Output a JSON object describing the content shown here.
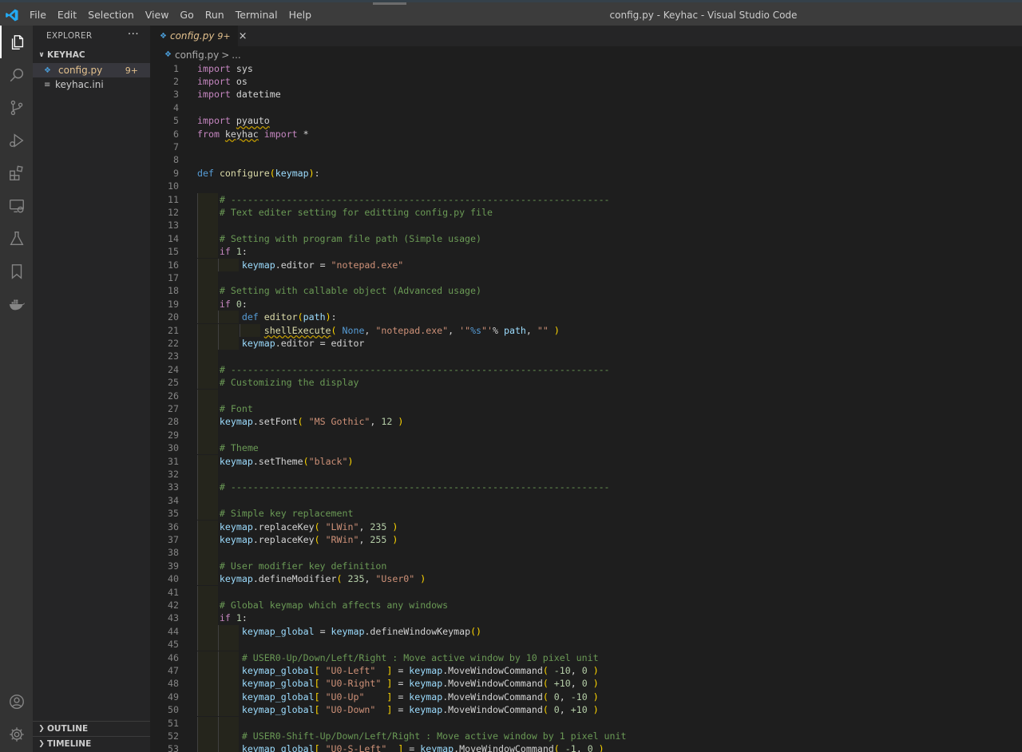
{
  "window": {
    "title": "config.py - Keyhac - Visual Studio Code",
    "menu": [
      "File",
      "Edit",
      "Selection",
      "View",
      "Go",
      "Run",
      "Terminal",
      "Help"
    ]
  },
  "activity_bar": {
    "items": [
      "files-icon",
      "search-icon",
      "source-control-icon",
      "run-debug-icon",
      "extensions-icon",
      "remote-explorer-icon",
      "testing-icon",
      "bookmarks-icon",
      "docker-icon"
    ],
    "bottom": [
      "account-icon",
      "settings-gear-icon"
    ]
  },
  "sidebar": {
    "header": "EXPLORER",
    "more": "···",
    "folder": "KEYHAC",
    "files": [
      {
        "name": "config.py",
        "badge": "9+",
        "selected": true
      },
      {
        "name": "keyhac.ini",
        "badge": "",
        "selected": false
      }
    ],
    "outline": "OUTLINE",
    "timeline": "TIMELINE"
  },
  "editor": {
    "tab": {
      "label": "config.py",
      "badge": "9+",
      "close": "×"
    },
    "breadcrumb": {
      "file": "config.py",
      "sep": ">",
      "rest": "..."
    },
    "lines": [
      [
        {
          "t": "import",
          "c": "k"
        },
        {
          "t": " sys"
        }
      ],
      [
        {
          "t": "import",
          "c": "k"
        },
        {
          "t": " os"
        }
      ],
      [
        {
          "t": "import",
          "c": "k"
        },
        {
          "t": " datetime"
        }
      ],
      [],
      [
        {
          "t": "import",
          "c": "k"
        },
        {
          "t": " "
        },
        {
          "t": "pyauto",
          "c": "sq"
        }
      ],
      [
        {
          "t": "from",
          "c": "k"
        },
        {
          "t": " "
        },
        {
          "t": "keyhac",
          "c": "sq"
        },
        {
          "t": " "
        },
        {
          "t": "import",
          "c": "k"
        },
        {
          "t": " *"
        }
      ],
      [],
      [],
      [
        {
          "t": "def",
          "c": "d"
        },
        {
          "t": " "
        },
        {
          "t": "configure",
          "c": "f"
        },
        {
          "t": "(",
          "c": "p"
        },
        {
          "t": "keymap",
          "c": "v"
        },
        {
          "t": ")",
          "c": "p"
        },
        {
          "t": ":"
        }
      ],
      [],
      [
        {
          "t": "    "
        },
        {
          "t": "# --------------------------------------------------------------------",
          "c": "c"
        }
      ],
      [
        {
          "t": "    "
        },
        {
          "t": "# Text editer setting for editting config.py file",
          "c": "c"
        }
      ],
      [],
      [
        {
          "t": "    "
        },
        {
          "t": "# Setting with program file path (Simple usage)",
          "c": "c"
        }
      ],
      [
        {
          "t": "    "
        },
        {
          "t": "if",
          "c": "k"
        },
        {
          "t": " "
        },
        {
          "t": "1",
          "c": "n"
        },
        {
          "t": ":"
        }
      ],
      [
        {
          "t": "        "
        },
        {
          "t": "keymap",
          "c": "v"
        },
        {
          "t": ".editor = "
        },
        {
          "t": "\"notepad.exe\"",
          "c": "s"
        }
      ],
      [],
      [
        {
          "t": "    "
        },
        {
          "t": "# Setting with callable object (Advanced usage)",
          "c": "c"
        }
      ],
      [
        {
          "t": "    "
        },
        {
          "t": "if",
          "c": "k"
        },
        {
          "t": " "
        },
        {
          "t": "0",
          "c": "n"
        },
        {
          "t": ":"
        }
      ],
      [
        {
          "t": "        "
        },
        {
          "t": "def",
          "c": "d"
        },
        {
          "t": " "
        },
        {
          "t": "editor",
          "c": "f"
        },
        {
          "t": "(",
          "c": "p"
        },
        {
          "t": "path",
          "c": "v"
        },
        {
          "t": ")",
          "c": "p"
        },
        {
          "t": ":"
        }
      ],
      [
        {
          "t": "            "
        },
        {
          "t": "shellExecute",
          "c": "f sq"
        },
        {
          "t": "(",
          "c": "p"
        },
        {
          "t": " "
        },
        {
          "t": "None",
          "c": "d"
        },
        {
          "t": ", "
        },
        {
          "t": "\"notepad.exe\"",
          "c": "s"
        },
        {
          "t": ", "
        },
        {
          "t": "'\"",
          "c": "s"
        },
        {
          "t": "%s",
          "c": "d"
        },
        {
          "t": "\"'",
          "c": "s"
        },
        {
          "t": "% "
        },
        {
          "t": "path",
          "c": "v"
        },
        {
          "t": ", "
        },
        {
          "t": "\"\"",
          "c": "s"
        },
        {
          "t": " "
        },
        {
          "t": ")",
          "c": "p"
        }
      ],
      [
        {
          "t": "        "
        },
        {
          "t": "keymap",
          "c": "v"
        },
        {
          "t": ".editor = editor"
        }
      ],
      [],
      [
        {
          "t": "    "
        },
        {
          "t": "# --------------------------------------------------------------------",
          "c": "c"
        }
      ],
      [
        {
          "t": "    "
        },
        {
          "t": "# Customizing the display",
          "c": "c"
        }
      ],
      [],
      [
        {
          "t": "    "
        },
        {
          "t": "# Font",
          "c": "c"
        }
      ],
      [
        {
          "t": "    "
        },
        {
          "t": "keymap",
          "c": "v"
        },
        {
          "t": ".setFont"
        },
        {
          "t": "(",
          "c": "p"
        },
        {
          "t": " "
        },
        {
          "t": "\"MS Gothic\"",
          "c": "s"
        },
        {
          "t": ", "
        },
        {
          "t": "12",
          "c": "n"
        },
        {
          "t": " "
        },
        {
          "t": ")",
          "c": "p"
        }
      ],
      [],
      [
        {
          "t": "    "
        },
        {
          "t": "# Theme",
          "c": "c"
        }
      ],
      [
        {
          "t": "    "
        },
        {
          "t": "keymap",
          "c": "v"
        },
        {
          "t": ".setTheme"
        },
        {
          "t": "(",
          "c": "p"
        },
        {
          "t": "\"black\"",
          "c": "s"
        },
        {
          "t": ")",
          "c": "p"
        }
      ],
      [],
      [
        {
          "t": "    "
        },
        {
          "t": "# --------------------------------------------------------------------",
          "c": "c"
        }
      ],
      [],
      [
        {
          "t": "    "
        },
        {
          "t": "# Simple key replacement",
          "c": "c"
        }
      ],
      [
        {
          "t": "    "
        },
        {
          "t": "keymap",
          "c": "v"
        },
        {
          "t": ".replaceKey"
        },
        {
          "t": "(",
          "c": "p"
        },
        {
          "t": " "
        },
        {
          "t": "\"LWin\"",
          "c": "s"
        },
        {
          "t": ", "
        },
        {
          "t": "235",
          "c": "n"
        },
        {
          "t": " "
        },
        {
          "t": ")",
          "c": "p"
        }
      ],
      [
        {
          "t": "    "
        },
        {
          "t": "keymap",
          "c": "v"
        },
        {
          "t": ".replaceKey"
        },
        {
          "t": "(",
          "c": "p"
        },
        {
          "t": " "
        },
        {
          "t": "\"RWin\"",
          "c": "s"
        },
        {
          "t": ", "
        },
        {
          "t": "255",
          "c": "n"
        },
        {
          "t": " "
        },
        {
          "t": ")",
          "c": "p"
        }
      ],
      [],
      [
        {
          "t": "    "
        },
        {
          "t": "# User modifier key definition",
          "c": "c"
        }
      ],
      [
        {
          "t": "    "
        },
        {
          "t": "keymap",
          "c": "v"
        },
        {
          "t": ".defineModifier"
        },
        {
          "t": "(",
          "c": "p"
        },
        {
          "t": " "
        },
        {
          "t": "235",
          "c": "n"
        },
        {
          "t": ", "
        },
        {
          "t": "\"User0\"",
          "c": "s"
        },
        {
          "t": " "
        },
        {
          "t": ")",
          "c": "p"
        }
      ],
      [],
      [
        {
          "t": "    "
        },
        {
          "t": "# Global keymap which affects any windows",
          "c": "c"
        }
      ],
      [
        {
          "t": "    "
        },
        {
          "t": "if",
          "c": "k"
        },
        {
          "t": " "
        },
        {
          "t": "1",
          "c": "n"
        },
        {
          "t": ":"
        }
      ],
      [
        {
          "t": "        "
        },
        {
          "t": "keymap_global",
          "c": "v"
        },
        {
          "t": " = "
        },
        {
          "t": "keymap",
          "c": "v"
        },
        {
          "t": ".defineWindowKeymap"
        },
        {
          "t": "()",
          "c": "p"
        }
      ],
      [],
      [
        {
          "t": "        "
        },
        {
          "t": "# USER0-Up/Down/Left/Right : Move active window by 10 pixel unit",
          "c": "c"
        }
      ],
      [
        {
          "t": "        "
        },
        {
          "t": "keymap_global",
          "c": "v"
        },
        {
          "t": "[",
          "c": "p"
        },
        {
          "t": " "
        },
        {
          "t": "\"U0-Left\"",
          "c": "s"
        },
        {
          "t": "  "
        },
        {
          "t": "]",
          "c": "p"
        },
        {
          "t": " = "
        },
        {
          "t": "keymap",
          "c": "v"
        },
        {
          "t": ".MoveWindowCommand"
        },
        {
          "t": "(",
          "c": "p"
        },
        {
          "t": " "
        },
        {
          "t": "-10",
          "c": "n"
        },
        {
          "t": ", "
        },
        {
          "t": "0",
          "c": "n"
        },
        {
          "t": " "
        },
        {
          "t": ")",
          "c": "p"
        }
      ],
      [
        {
          "t": "        "
        },
        {
          "t": "keymap_global",
          "c": "v"
        },
        {
          "t": "[",
          "c": "p"
        },
        {
          "t": " "
        },
        {
          "t": "\"U0-Right\"",
          "c": "s"
        },
        {
          "t": " "
        },
        {
          "t": "]",
          "c": "p"
        },
        {
          "t": " = "
        },
        {
          "t": "keymap",
          "c": "v"
        },
        {
          "t": ".MoveWindowCommand"
        },
        {
          "t": "(",
          "c": "p"
        },
        {
          "t": " "
        },
        {
          "t": "+10",
          "c": "n"
        },
        {
          "t": ", "
        },
        {
          "t": "0",
          "c": "n"
        },
        {
          "t": " "
        },
        {
          "t": ")",
          "c": "p"
        }
      ],
      [
        {
          "t": "        "
        },
        {
          "t": "keymap_global",
          "c": "v"
        },
        {
          "t": "[",
          "c": "p"
        },
        {
          "t": " "
        },
        {
          "t": "\"U0-Up\"",
          "c": "s"
        },
        {
          "t": "    "
        },
        {
          "t": "]",
          "c": "p"
        },
        {
          "t": " = "
        },
        {
          "t": "keymap",
          "c": "v"
        },
        {
          "t": ".MoveWindowCommand"
        },
        {
          "t": "(",
          "c": "p"
        },
        {
          "t": " "
        },
        {
          "t": "0",
          "c": "n"
        },
        {
          "t": ", "
        },
        {
          "t": "-10",
          "c": "n"
        },
        {
          "t": " "
        },
        {
          "t": ")",
          "c": "p"
        }
      ],
      [
        {
          "t": "        "
        },
        {
          "t": "keymap_global",
          "c": "v"
        },
        {
          "t": "[",
          "c": "p"
        },
        {
          "t": " "
        },
        {
          "t": "\"U0-Down\"",
          "c": "s"
        },
        {
          "t": "  "
        },
        {
          "t": "]",
          "c": "p"
        },
        {
          "t": " = "
        },
        {
          "t": "keymap",
          "c": "v"
        },
        {
          "t": ".MoveWindowCommand"
        },
        {
          "t": "(",
          "c": "p"
        },
        {
          "t": " "
        },
        {
          "t": "0",
          "c": "n"
        },
        {
          "t": ", "
        },
        {
          "t": "+10",
          "c": "n"
        },
        {
          "t": " "
        },
        {
          "t": ")",
          "c": "p"
        }
      ],
      [],
      [
        {
          "t": "        "
        },
        {
          "t": "# USER0-Shift-Up/Down/Left/Right : Move active window by 1 pixel unit",
          "c": "c"
        }
      ],
      [
        {
          "t": "        "
        },
        {
          "t": "keymap_global",
          "c": "v"
        },
        {
          "t": "[",
          "c": "p"
        },
        {
          "t": " "
        },
        {
          "t": "\"U0-S-Left\"",
          "c": "s"
        },
        {
          "t": "  "
        },
        {
          "t": "]",
          "c": "p"
        },
        {
          "t": " = "
        },
        {
          "t": "keymap",
          "c": "v"
        },
        {
          "t": ".MoveWindowCommand"
        },
        {
          "t": "(",
          "c": "p"
        },
        {
          "t": " "
        },
        {
          "t": "-1",
          "c": "n"
        },
        {
          "t": ", "
        },
        {
          "t": "0",
          "c": "n"
        },
        {
          "t": " "
        },
        {
          "t": ")",
          "c": "p"
        }
      ]
    ]
  }
}
